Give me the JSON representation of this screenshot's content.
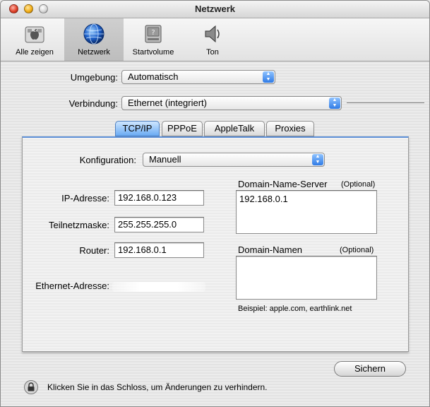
{
  "window": {
    "title": "Netzwerk"
  },
  "toolbar": {
    "items": [
      {
        "label": "Alle zeigen",
        "icon": "apple-icon"
      },
      {
        "label": "Netzwerk",
        "icon": "globe-icon",
        "selected": true
      },
      {
        "label": "Startvolume",
        "icon": "disk-icon"
      },
      {
        "label": "Ton",
        "icon": "speaker-icon"
      }
    ]
  },
  "location": {
    "label": "Umgebung:",
    "value": "Automatisch"
  },
  "connection": {
    "label": "Verbindung:",
    "value": "Ethernet (integriert)"
  },
  "tabs": [
    "TCP/IP",
    "PPPoE",
    "AppleTalk",
    "Proxies"
  ],
  "active_tab": "TCP/IP",
  "tcpip": {
    "config_label": "Konfiguration:",
    "config_value": "Manuell",
    "ip_label": "IP-Adresse:",
    "ip_value": "192.168.0.123",
    "subnet_label": "Teilnetzmaske:",
    "subnet_value": "255.255.255.0",
    "router_label": "Router:",
    "router_value": "192.168.0.1",
    "ethernet_label": "Ethernet-Adresse:",
    "dns_label": "Domain-Name-Server",
    "dns_optional": "(Optional)",
    "dns_value": "192.168.0.1",
    "domains_label": "Domain-Namen",
    "domains_optional": "(Optional)",
    "domains_value": "",
    "example": "Beispiel: apple.com, earthlink.net"
  },
  "apply_button": "Sichern",
  "lock_text": "Klicken Sie in das Schloss, um Änderungen zu verhindern.",
  "colors": {
    "accent": "#5c8fd6",
    "selected_tab": "#6aaaf3"
  }
}
